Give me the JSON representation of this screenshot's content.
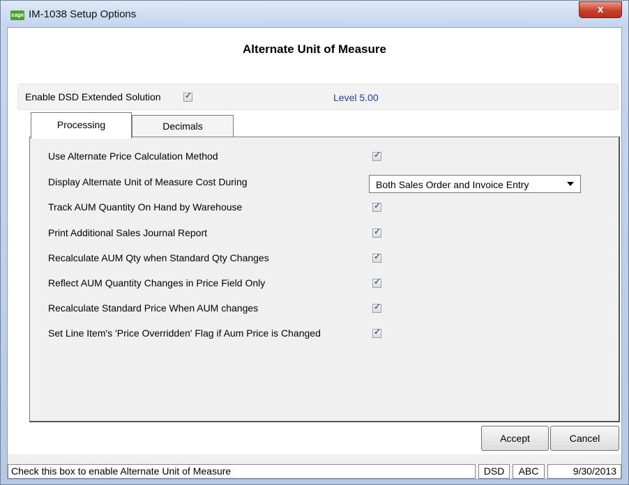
{
  "window": {
    "title": "IM-1038 Setup Options",
    "app_icon_text": "sage",
    "close_glyph": "x"
  },
  "header": {
    "title": "Alternate Unit of Measure"
  },
  "dsd": {
    "enable_label": "Enable DSD Extended Solution",
    "enable_checked": true,
    "level_text": "Level  5.00"
  },
  "tabs": [
    {
      "label": "Processing",
      "active": true
    },
    {
      "label": "Decimals",
      "active": false
    }
  ],
  "options": [
    {
      "label": "Use Alternate Price Calculation Method",
      "checked": true
    },
    {
      "label": "Display Alternate Unit of Measure Cost During",
      "select_value": "Both Sales Order and Invoice Entry"
    },
    {
      "label": "Track AUM Quantity On Hand by Warehouse",
      "checked": true
    },
    {
      "label": "Print Additional Sales Journal Report",
      "checked": true
    },
    {
      "label": "Recalculate AUM Qty when Standard Qty Changes",
      "checked": true
    },
    {
      "label": "Reflect AUM Quantity Changes in Price Field Only",
      "checked": true
    },
    {
      "label": "Recalculate Standard Price When AUM changes",
      "checked": true
    },
    {
      "label": "Set Line Item's 'Price Overridden' Flag if Aum Price is Changed",
      "checked": true
    }
  ],
  "buttons": {
    "accept_label": "Accept",
    "cancel_label": "Cancel"
  },
  "statusbar": {
    "message": "Check this box to enable Alternate Unit of Measure",
    "module": "DSD",
    "company": "ABC",
    "date": "9/30/2013"
  },
  "colors": {
    "level_text": "#1c3fa8",
    "close_button": "#c9412c",
    "checkmark": "#3a5fb0"
  }
}
